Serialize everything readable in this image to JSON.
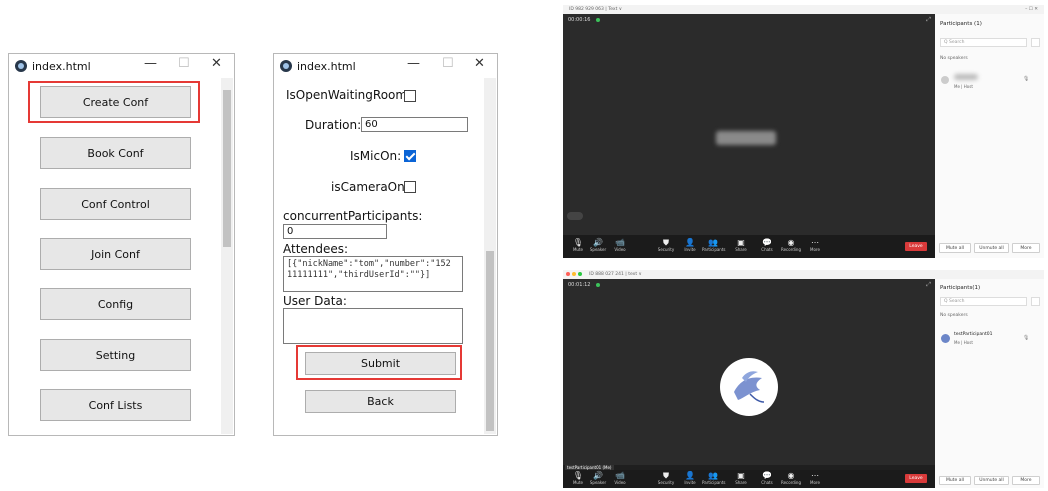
{
  "left_window": {
    "title": "index.html",
    "controls": {
      "min": "—",
      "max": "☐",
      "close": "✕"
    },
    "buttons": [
      "Create Conf",
      "Book Conf",
      "Conf Control",
      "Join Conf",
      "Config",
      "Setting",
      "Conf Lists"
    ]
  },
  "form_window": {
    "title": "index.html",
    "controls": {
      "min": "—",
      "max": "☐",
      "close": "✕"
    },
    "fields": {
      "waiting_room_label": "IsOpenWaitingRoom:",
      "duration_label": "Duration:",
      "duration_value": "60",
      "mic_label": "IsMicOn:",
      "camera_label": "isCameraOn:",
      "concurrent_label": "concurrentParticipants:",
      "concurrent_value": "0",
      "attendees_label": "Attendees:",
      "attendees_value": "[{\"nickName\":\"tom\",\"number\":\"152\n11111111\",\"thirdUserId\":\"\"}]",
      "user_data_label": "User Data:",
      "user_data_value": ""
    },
    "checkboxes": {
      "waiting_room": false,
      "mic": true,
      "camera": false
    },
    "submit_label": "Submit",
    "back_label": "Back"
  },
  "meeting_top": {
    "title": "ID 982 929 063 | Text ∨",
    "timer": "00:00:16",
    "window_controls": "– ☐ ✕",
    "sidebar": {
      "title": "Participants (1)",
      "search": "Q Search",
      "speakers": "No speakers",
      "participant_sub": "Me | Host",
      "mute_all": "Mute all",
      "unmute_all": "Unmute all",
      "more": "More"
    }
  },
  "meeting_bottom": {
    "title": "ID 888 027 241 | text ∨",
    "timer": "00:01:12",
    "sidebar": {
      "title": "Participants(1)",
      "search": "Q Search",
      "speakers": "No speakers",
      "participant_name": "testParticipant01",
      "participant_sub": "Me | Host",
      "mute_all": "Mute all",
      "unmute_all": "Unmute all",
      "more": "More"
    },
    "name_tag": "testParticipant01 (Me)"
  },
  "toolbar": {
    "items": [
      {
        "label": "Mute",
        "icon": "microphone-icon",
        "glyph": "🎙"
      },
      {
        "label": "Speaker",
        "icon": "speaker-icon",
        "glyph": "🔊"
      },
      {
        "label": "Video",
        "icon": "video-icon",
        "glyph": "📹"
      },
      {
        "label": "Security",
        "icon": "shield-icon",
        "glyph": "⛊"
      },
      {
        "label": "Invite",
        "icon": "invite-icon",
        "glyph": "👤"
      },
      {
        "label": "Participants",
        "icon": "participants-icon",
        "glyph": "👥"
      },
      {
        "label": "Share",
        "icon": "share-icon",
        "glyph": "▣"
      },
      {
        "label": "Chats",
        "icon": "chat-icon",
        "glyph": "💬"
      },
      {
        "label": "Recording",
        "icon": "record-icon",
        "glyph": "◉"
      },
      {
        "label": "More",
        "icon": "more-icon",
        "glyph": "⋯"
      }
    ],
    "leave_label": "Leave"
  },
  "colors": {
    "highlight": "#e53935",
    "meeting_bg": "#2b2b2b",
    "leave": "#d93a3a",
    "check": "#0a64d6"
  }
}
